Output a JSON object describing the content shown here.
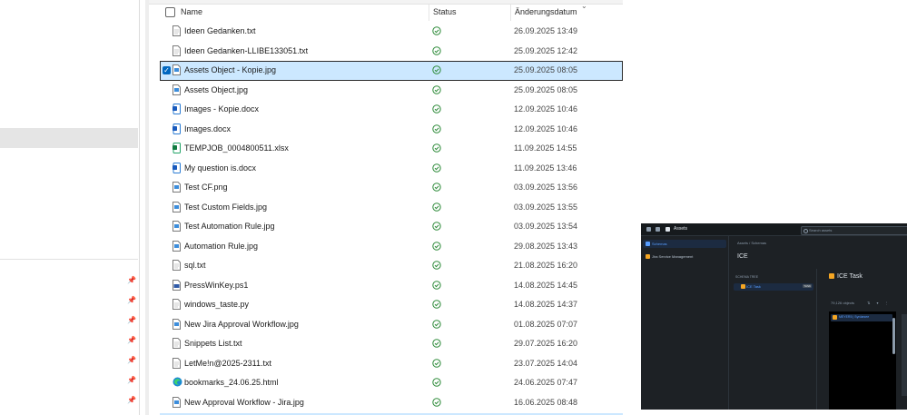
{
  "columns": {
    "name": "Name",
    "status": "Status",
    "date": "Änderungsdatum"
  },
  "files": [
    {
      "name": "Ideen Gedanken.txt",
      "type": "txt",
      "date": "26.09.2025 13:49",
      "selected": false
    },
    {
      "name": "Ideen Gedanken-LLIBE133051.txt",
      "type": "txt",
      "date": "25.09.2025 12:42",
      "selected": false
    },
    {
      "name": "Assets Object - Kopie.jpg",
      "type": "img",
      "date": "25.09.2025 08:05",
      "selected": true
    },
    {
      "name": "Assets Object.jpg",
      "type": "img",
      "date": "25.09.2025 08:05",
      "selected": false
    },
    {
      "name": "Images - Kopie.docx",
      "type": "docx",
      "date": "12.09.2025 10:46",
      "selected": false
    },
    {
      "name": "Images.docx",
      "type": "docx",
      "date": "12.09.2025 10:46",
      "selected": false
    },
    {
      "name": "TEMPJOB_0004800511.xlsx",
      "type": "xlsx",
      "date": "11.09.2025 14:55",
      "selected": false
    },
    {
      "name": "My question is.docx",
      "type": "docx",
      "date": "11.09.2025 13:46",
      "selected": false
    },
    {
      "name": "Test CF.png",
      "type": "img",
      "date": "03.09.2025 13:56",
      "selected": false
    },
    {
      "name": "Test Custom Fields.jpg",
      "type": "img",
      "date": "03.09.2025 13:55",
      "selected": false
    },
    {
      "name": "Test Automation Rule.jpg",
      "type": "img",
      "date": "03.09.2025 13:54",
      "selected": false
    },
    {
      "name": "Automation Rule.jpg",
      "type": "img",
      "date": "29.08.2025 13:43",
      "selected": false
    },
    {
      "name": "sql.txt",
      "type": "txt",
      "date": "21.08.2025 16:20",
      "selected": false
    },
    {
      "name": "PressWinKey.ps1",
      "type": "ps1",
      "date": "14.08.2025 14:45",
      "selected": false
    },
    {
      "name": "windows_taste.py",
      "type": "py",
      "date": "14.08.2025 14:37",
      "selected": false
    },
    {
      "name": "New Jira Approval Workflow.jpg",
      "type": "img",
      "date": "01.08.2025 07:07",
      "selected": false
    },
    {
      "name": "Snippets List.txt",
      "type": "txt",
      "date": "29.07.2025 16:20",
      "selected": false
    },
    {
      "name": "LetMe!n@2025-2311.txt",
      "type": "txt",
      "date": "23.07.2025 14:04",
      "selected": false
    },
    {
      "name": "bookmarks_24.06.25.html",
      "type": "html",
      "date": "24.06.2025 07:47",
      "selected": false
    },
    {
      "name": "New Approval Workflow - Jira.jpg",
      "type": "img",
      "date": "16.06.2025 08:48",
      "selected": false
    }
  ],
  "colors": {
    "selection": "#cce8ff",
    "status_ok": "#2e8b3a",
    "accent": "#0067c0"
  },
  "preview": {
    "app_name": "Assets",
    "search_placeholder": "Search assets",
    "sidebar": [
      "Schemas",
      "Jira Service Management"
    ],
    "breadcrumb": "Assets  /  Schemas",
    "page_title": "ICE",
    "schema_tree_heading": "SCHEMA TREE",
    "tree_item": "ICE Task",
    "tree_badge": "TASK",
    "object_title": "ICE Task",
    "object_count": "79,126 objects",
    "object_item": "MEYER5 | Syrdarsee"
  }
}
